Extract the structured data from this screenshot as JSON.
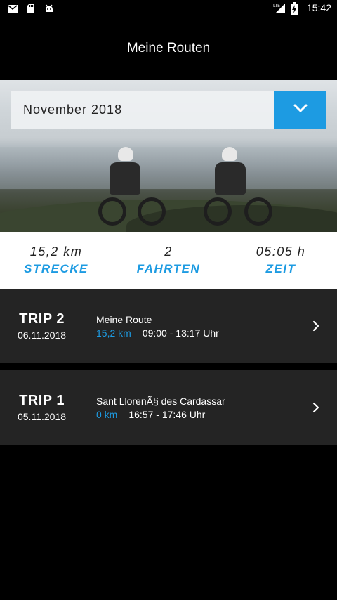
{
  "status_bar": {
    "time": "15:42",
    "icons_left": [
      "gmail-icon",
      "sd-card-icon",
      "android-icon"
    ],
    "icons_right": [
      "lte-signal-icon",
      "battery-charging-icon"
    ],
    "network": "LTE"
  },
  "app_bar": {
    "title": "Meine Routen"
  },
  "month_select": {
    "value": "November 2018"
  },
  "stats": [
    {
      "value": "15,2 km",
      "label": "STRECKE"
    },
    {
      "value": "2",
      "label": "FAHRTEN"
    },
    {
      "value": "05:05 h",
      "label": "ZEIT"
    }
  ],
  "trips": [
    {
      "name": "TRIP 2",
      "date": "06.11.2018",
      "route": "Meine Route",
      "distance": "15,2 km",
      "time": "09:00 - 13:17 Uhr"
    },
    {
      "name": "TRIP 1",
      "date": "05.11.2018",
      "route": "Sant LlorenÃ§ des Cardassar",
      "distance": "0 km",
      "time": "16:57 - 17:46 Uhr"
    }
  ],
  "colors": {
    "accent": "#1d9be2",
    "trip_bg": "#242424",
    "background": "#000000"
  }
}
